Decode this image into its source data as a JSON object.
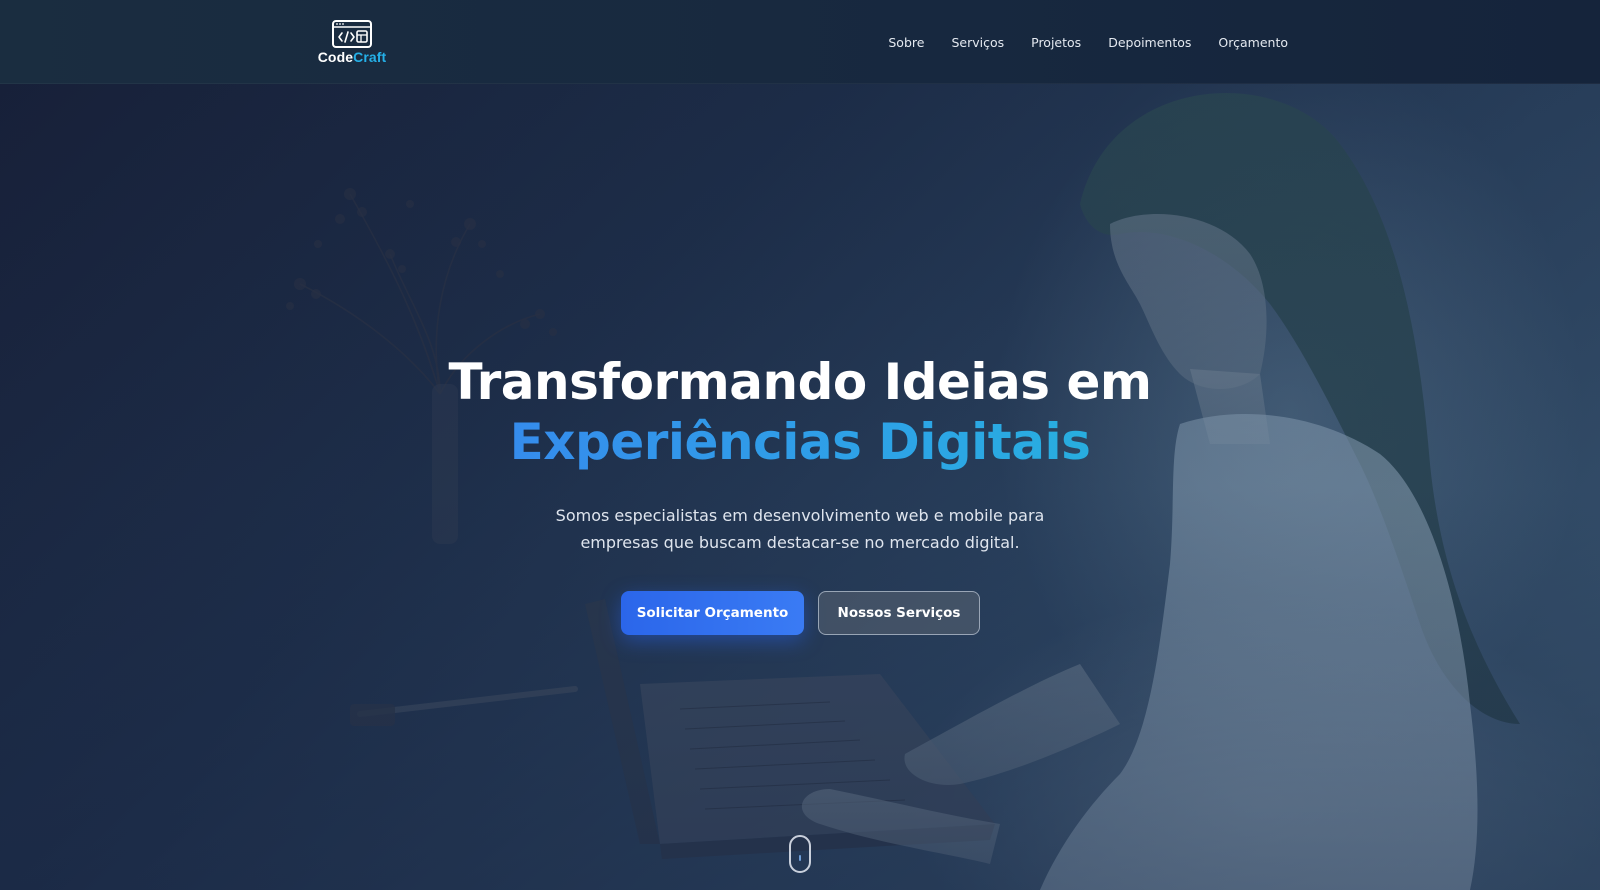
{
  "brand": {
    "name_part1": "Code",
    "name_part2": "Craft",
    "logo_icon": "browser-code-icon"
  },
  "nav": {
    "items": [
      {
        "label": "Sobre"
      },
      {
        "label": "Serviços"
      },
      {
        "label": "Projetos"
      },
      {
        "label": "Depoimentos"
      },
      {
        "label": "Orçamento"
      }
    ]
  },
  "hero": {
    "title_line1": "Transformando Ideias em",
    "title_line2": "Experiências Digitais",
    "subtitle_line1": "Somos especialistas em desenvolvimento web e mobile para",
    "subtitle_line2": "empresas que buscam destacar-se no mercado digital.",
    "primary_button": "Solicitar Orçamento",
    "secondary_button": "Nossos Serviços",
    "scroll_icon": "mouse-scroll-icon"
  },
  "colors": {
    "navbar_bg": "#182a3f",
    "accent_blue": "#2b66ea",
    "accent_cyan": "#25b0e8",
    "text_white": "#ffffff"
  }
}
